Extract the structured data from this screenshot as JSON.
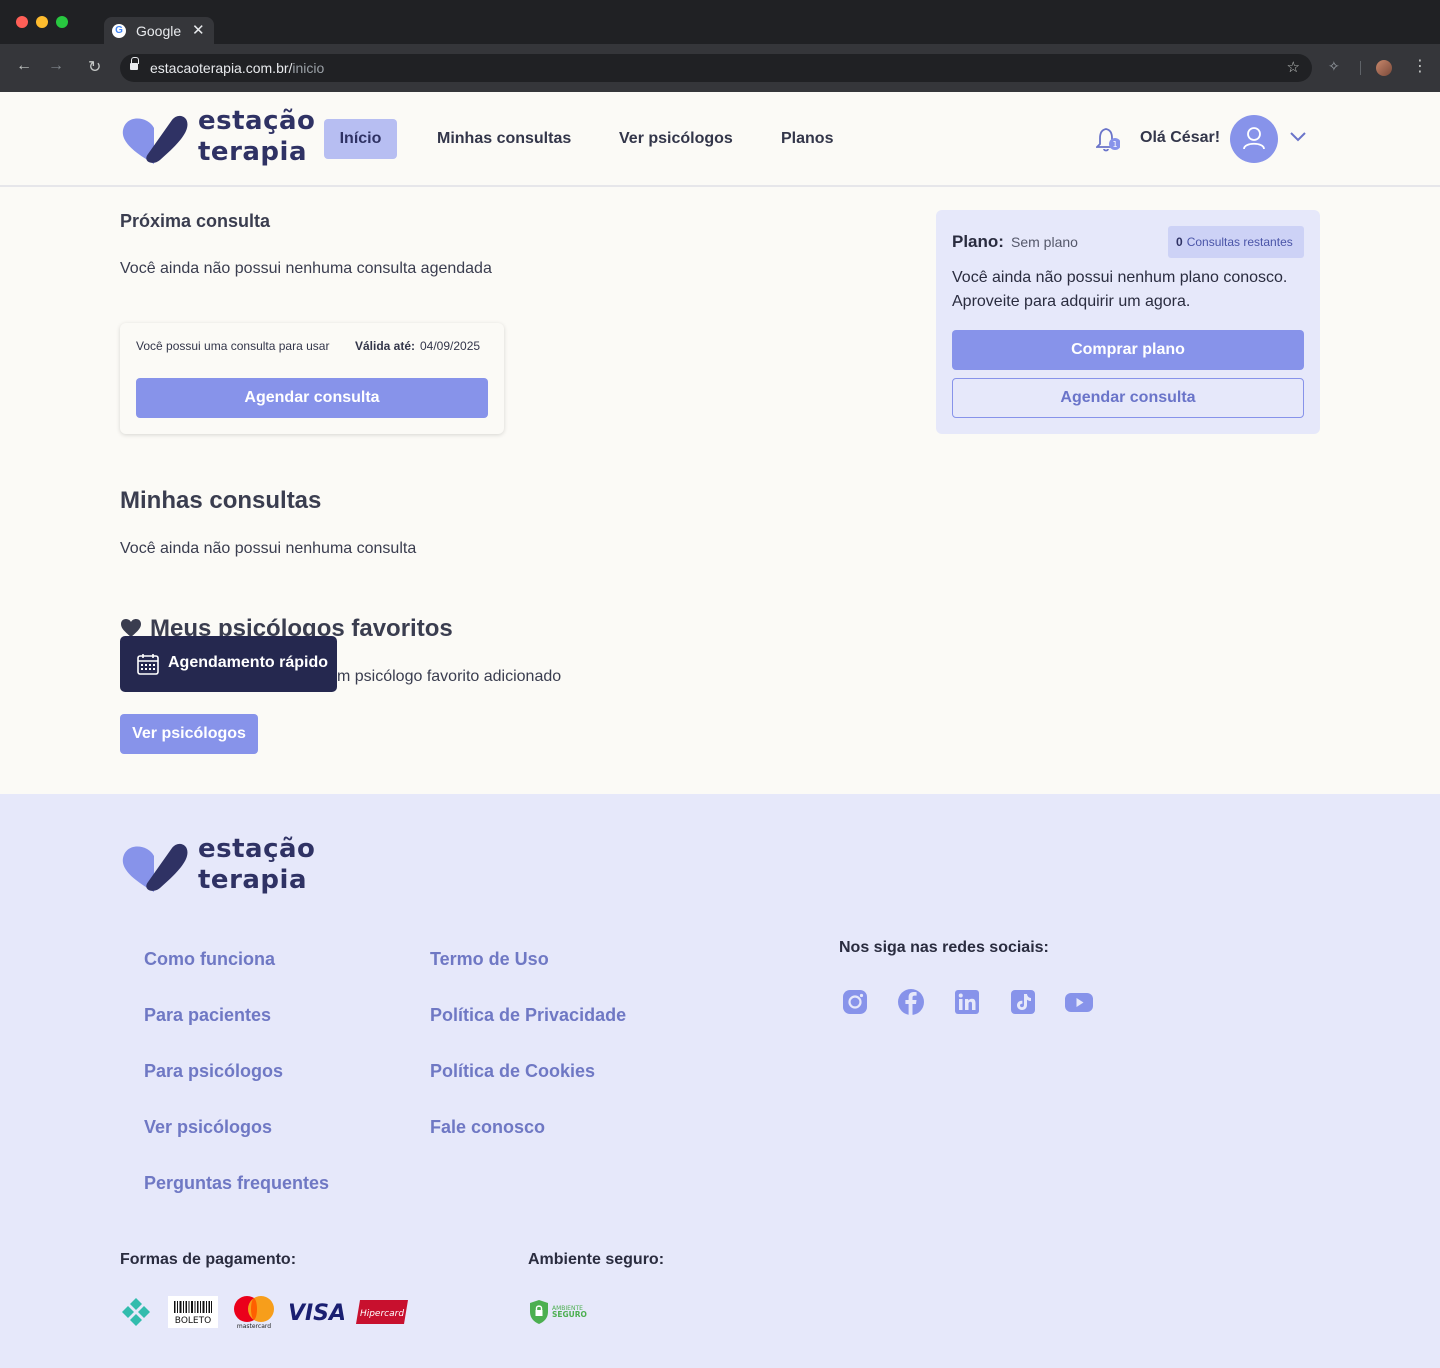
{
  "browser": {
    "tab_title": "Google",
    "tab_favicon": "G",
    "url_domain": "estacaoterapia.com.br/",
    "url_path": "inicio",
    "tab_close": "✕"
  },
  "logo": {
    "line1": "estação",
    "line2": "terapia"
  },
  "nav": {
    "items": [
      {
        "label": "Início",
        "active": true
      },
      {
        "label": "Minhas consultas",
        "active": false
      },
      {
        "label": "Ver psicólogos",
        "active": false
      },
      {
        "label": "Planos",
        "active": false
      }
    ]
  },
  "user": {
    "greeting": "Olá César!",
    "notification_count": "1"
  },
  "next_consult": {
    "title": "Próxima consulta",
    "empty_text": "Você ainda não possui nenhuma consulta agendada",
    "card_text": "Você possui uma consulta para usar",
    "valid_label": "Válida até:",
    "valid_date": "04/09/2025",
    "button": "Agendar consulta"
  },
  "plan": {
    "label": "Plano:",
    "value": "Sem plano",
    "badge_count": "0",
    "badge_text": "Consultas restantes",
    "description": "Você ainda não possui nenhum plano conosco. Aproveite para adquirir um agora.",
    "buy_button": "Comprar plano",
    "schedule_button": "Agendar consulta"
  },
  "my_consults": {
    "title": "Minhas consultas",
    "empty_text": "Você ainda não possui nenhuma consulta"
  },
  "favorites": {
    "title": "Meus psicólogos favoritos",
    "empty_text_visible": "m psicólogo favorito adicionado",
    "button": "Ver psicólogos"
  },
  "quick_schedule": {
    "label": "Agendamento rápido"
  },
  "footer": {
    "col1": [
      "Como funciona",
      "Para pacientes",
      "Para psicólogos",
      "Ver psicólogos",
      "Perguntas frequentes"
    ],
    "col2": [
      "Termo de Uso",
      "Política de Privacidade",
      "Política de Cookies",
      "Fale conosco"
    ],
    "social_heading": "Nos siga nas redes sociais:",
    "social_icons": [
      "instagram-icon",
      "facebook-icon",
      "linkedin-icon",
      "tiktok-icon",
      "youtube-icon"
    ],
    "payment_heading": "Formas de pagamento:",
    "payment_labels": {
      "boleto": "BOLETO",
      "mastercard": "mastercard",
      "visa": "VISA",
      "hipercard": "Hipercard"
    },
    "secure_heading": "Ambiente seguro:",
    "secure_badge": {
      "line1": "AMBIENTE",
      "line2": "SEGURO"
    }
  },
  "colors": {
    "accent": "#8793ea",
    "accent_light": "#b7bef2",
    "navy": "#25284f",
    "footer_bg": "#e6e8fa",
    "link": "#6f78c4"
  }
}
